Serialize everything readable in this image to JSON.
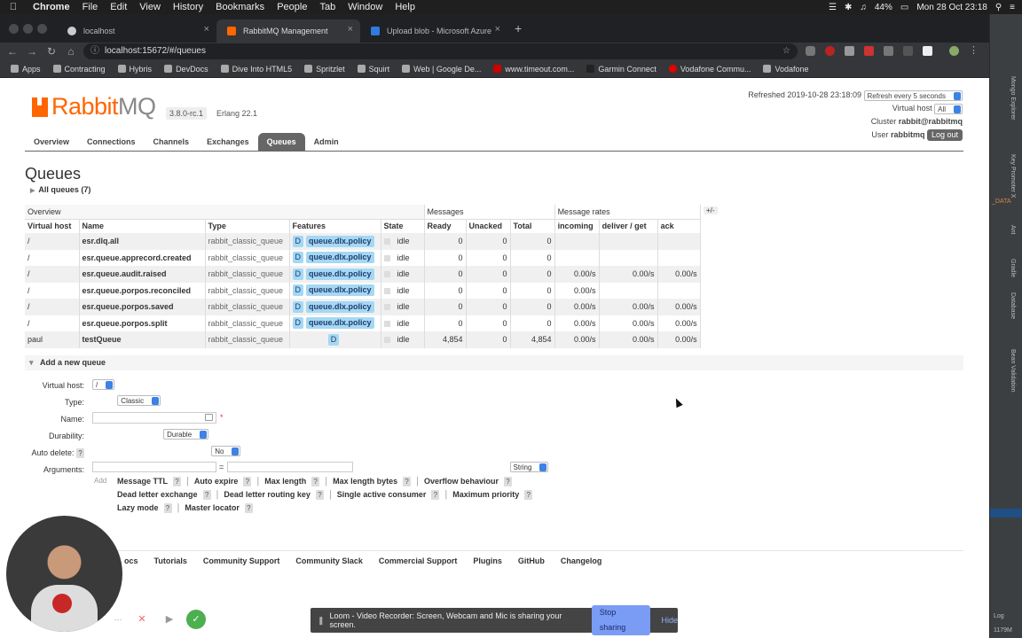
{
  "menubar": {
    "app": "Chrome",
    "items": [
      "File",
      "Edit",
      "View",
      "History",
      "Bookmarks",
      "People",
      "Tab",
      "Window",
      "Help"
    ],
    "battery": "44%",
    "clock": "Mon 28 Oct 23:18"
  },
  "browser": {
    "tabs": [
      {
        "title": "localhost",
        "icon": "github-icon"
      },
      {
        "title": "RabbitMQ Management",
        "icon": "rabbitmq-icon"
      },
      {
        "title": "Upload blob - Microsoft Azure",
        "icon": "azure-icon"
      }
    ],
    "url": "localhost:15672/#/queues",
    "bookmarks": [
      "Apps",
      "Contracting",
      "Hybris",
      "DevDocs",
      "Dive Into HTML5",
      "Spritzlet",
      "Squirt",
      "Web | Google De...",
      "www.timeout.com...",
      "Garmin Connect",
      "Vodafone Commu...",
      "Vodafone"
    ]
  },
  "header": {
    "logo_main": "Rabbit",
    "logo_suffix": "MQ",
    "version": "3.8.0-rc.1",
    "erlang": "Erlang 22.1",
    "refreshed": "Refreshed 2019-10-28 23:18:09",
    "refresh_option": "Refresh every 5 seconds",
    "vhost_label": "Virtual host",
    "vhost_value": "All",
    "cluster_label": "Cluster",
    "cluster_value": "rabbit@rabbitmq",
    "user_label": "User",
    "user_value": "rabbitmq",
    "logout": "Log out"
  },
  "nav": [
    "Overview",
    "Connections",
    "Channels",
    "Exchanges",
    "Queues",
    "Admin"
  ],
  "page_title": "Queues",
  "all_queues": "All queues (7)",
  "table": {
    "group_overview": "Overview",
    "group_messages": "Messages",
    "group_rates": "Message rates",
    "plusminus": "+/-",
    "columns": [
      "Virtual host",
      "Name",
      "Type",
      "Features",
      "State",
      "Ready",
      "Unacked",
      "Total",
      "incoming",
      "deliver / get",
      "ack"
    ],
    "rows": [
      {
        "vhost": "/",
        "name": "esr.dlq.all",
        "type": "rabbit_classic_queue",
        "featD": "D",
        "feat": "queue.dlx.policy",
        "state": "idle",
        "ready": "0",
        "unacked": "0",
        "total": "0",
        "incoming": "",
        "deliver": "",
        "ack": ""
      },
      {
        "vhost": "/",
        "name": "esr.queue.apprecord.created",
        "type": "rabbit_classic_queue",
        "featD": "D",
        "feat": "queue.dlx.policy",
        "state": "idle",
        "ready": "0",
        "unacked": "0",
        "total": "0",
        "incoming": "",
        "deliver": "",
        "ack": ""
      },
      {
        "vhost": "/",
        "name": "esr.queue.audit.raised",
        "type": "rabbit_classic_queue",
        "featD": "D",
        "feat": "queue.dlx.policy",
        "state": "idle",
        "ready": "0",
        "unacked": "0",
        "total": "0",
        "incoming": "0.00/s",
        "deliver": "0.00/s",
        "ack": "0.00/s"
      },
      {
        "vhost": "/",
        "name": "esr.queue.porpos.reconciled",
        "type": "rabbit_classic_queue",
        "featD": "D",
        "feat": "queue.dlx.policy",
        "state": "idle",
        "ready": "0",
        "unacked": "0",
        "total": "0",
        "incoming": "0.00/s",
        "deliver": "",
        "ack": ""
      },
      {
        "vhost": "/",
        "name": "esr.queue.porpos.saved",
        "type": "rabbit_classic_queue",
        "featD": "D",
        "feat": "queue.dlx.policy",
        "state": "idle",
        "ready": "0",
        "unacked": "0",
        "total": "0",
        "incoming": "0.00/s",
        "deliver": "0.00/s",
        "ack": "0.00/s"
      },
      {
        "vhost": "/",
        "name": "esr.queue.porpos.split",
        "type": "rabbit_classic_queue",
        "featD": "D",
        "feat": "queue.dlx.policy",
        "state": "idle",
        "ready": "0",
        "unacked": "0",
        "total": "0",
        "incoming": "0.00/s",
        "deliver": "0.00/s",
        "ack": "0.00/s"
      },
      {
        "vhost": "paul",
        "name": "testQueue",
        "type": "rabbit_classic_queue",
        "featD": "D",
        "feat": "",
        "state": "idle",
        "ready": "4,854",
        "unacked": "0",
        "total": "4,854",
        "incoming": "0.00/s",
        "deliver": "0.00/s",
        "ack": "0.00/s"
      }
    ]
  },
  "add_queue": {
    "header": "Add a new queue",
    "vhost_label": "Virtual host:",
    "vhost_value": "/",
    "type_label": "Type:",
    "type_value": "Classic",
    "name_label": "Name:",
    "required": "*",
    "durability_label": "Durability:",
    "durability_value": "Durable",
    "autodelete_label": "Auto delete:",
    "autodelete_help": "?",
    "autodelete_value": "No",
    "arguments_label": "Arguments:",
    "equals": "=",
    "arg_type": "String",
    "add": "Add",
    "arg_keys_row1": [
      "Message TTL",
      "Auto expire",
      "Max length",
      "Max length bytes",
      "Overflow behaviour"
    ],
    "arg_keys_row2": [
      "Dead letter exchange",
      "Dead letter routing key",
      "Single active consumer",
      "Maximum priority"
    ],
    "arg_keys_row3": [
      "Lazy mode",
      "Master locator"
    ]
  },
  "footer": [
    "Docs",
    "Tutorials",
    "Community Support",
    "Community Slack",
    "Commercial Support",
    "Plugins",
    "GitHub",
    "Changelog"
  ],
  "footer_visible_first": "ocs",
  "loom": {
    "message": "Loom - Video Recorder: Screen, Webcam and Mic is sharing your screen.",
    "stop": "Stop sharing",
    "hide": "Hide"
  },
  "ide": {
    "labels": [
      "Mongo Explorer",
      "Key Promoter X",
      "Ant",
      "Gradle",
      "Database",
      "Bean Validation"
    ],
    "snippet": "_DATA",
    "log": "Log",
    "memory": "1179M"
  }
}
